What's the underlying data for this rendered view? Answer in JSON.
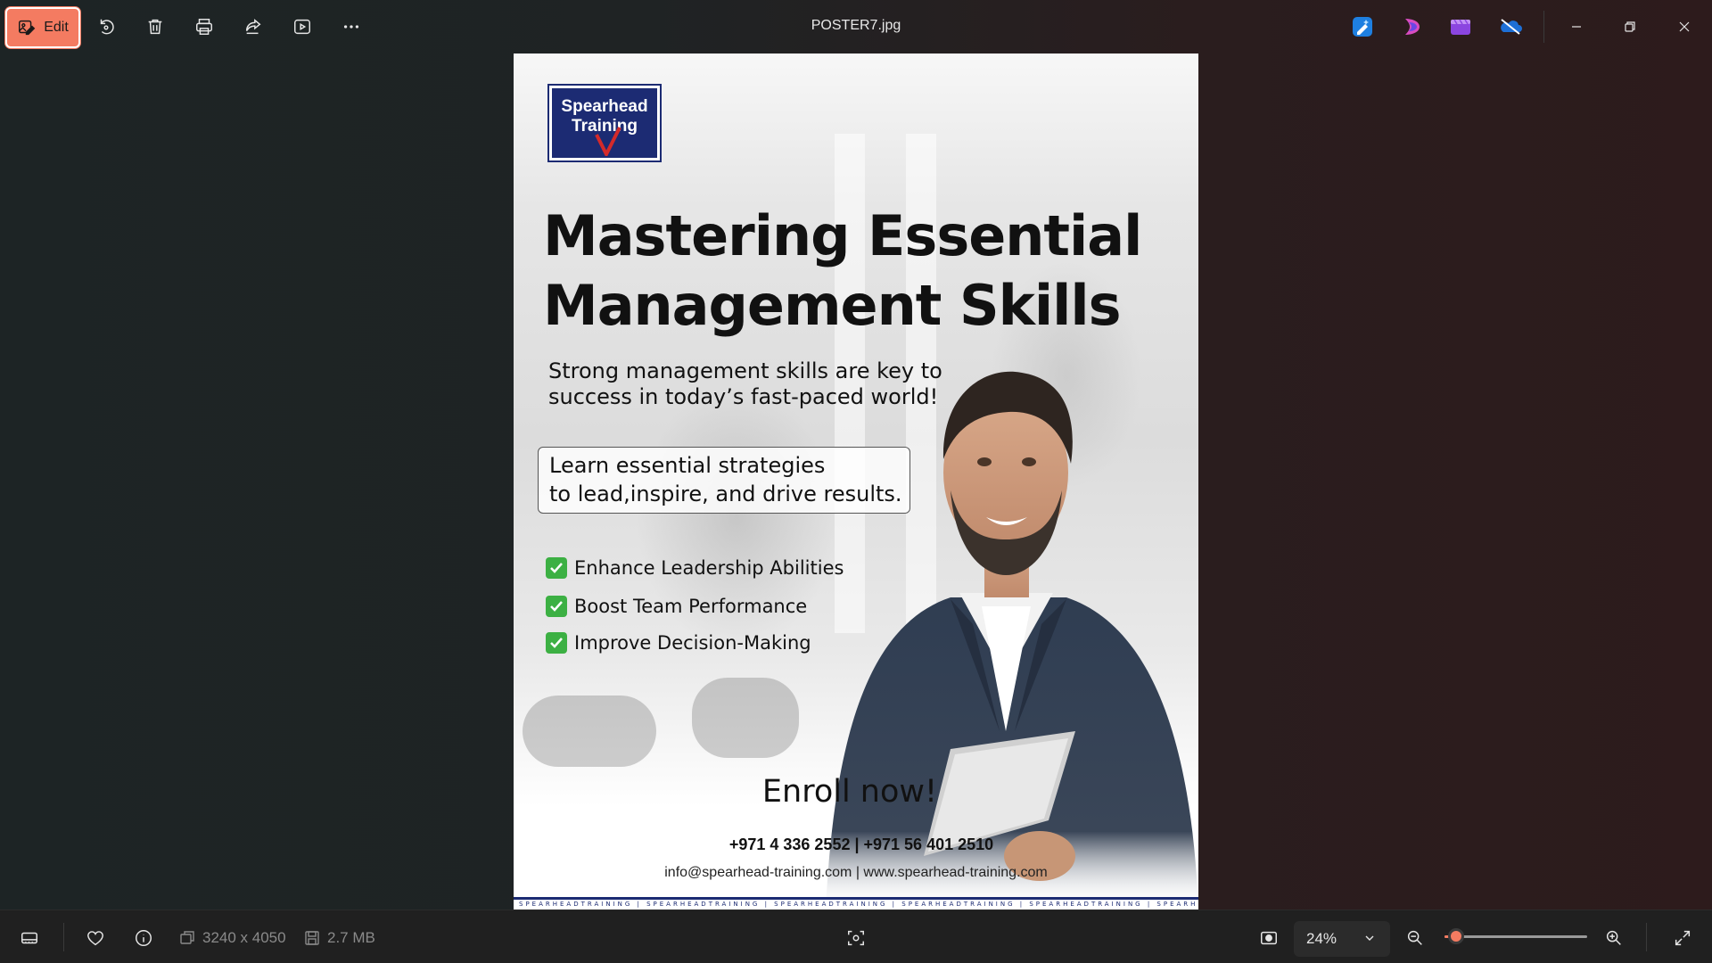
{
  "toolbar": {
    "edit_label": "Edit",
    "file_name": "POSTER7.jpg",
    "icons": [
      "rotate-icon",
      "delete-icon",
      "print-icon",
      "share-icon",
      "slideshow-icon",
      "more-icon"
    ]
  },
  "apps": [
    "photos-ai-icon",
    "clipchamp-icon",
    "video-editor-icon",
    "onedrive-icon"
  ],
  "poster": {
    "logo_line1": "Spearhead",
    "logo_line2": "Training",
    "headline_line1": "Mastering Essential",
    "headline_line2": "Management Skills",
    "subtitle_line1": "Strong management skills are key to",
    "subtitle_line2": "success in today’s fast-paced world!",
    "box_line1": "Learn essential strategies",
    "box_line2": "to lead,inspire, and drive results.",
    "benefits": [
      "Enhance Leadership Abilities",
      "Boost Team Performance",
      "Improve Decision-Making"
    ],
    "cta": "Enroll now!",
    "phones": "+971 4 336 2552 | +971 56 401 2510",
    "contact": "info@spearhead-training.com | www.spearhead-training.com",
    "footer": "SPEARHEADTRAINING | SPEARHEADTRAINING | SPEARHEADTRAINING | SPEARHEADTRAINING | SPEARHEADTRAINING | SPEARHEADTRAINING"
  },
  "status": {
    "dimensions": "3240 x 4050",
    "file_size": "2.7 MB",
    "zoom": "24%",
    "zoom_fraction": 0.08
  },
  "colors": {
    "accent": "#f47b61",
    "logo_blue": "#1c2b73",
    "check_green": "#3cb043"
  }
}
